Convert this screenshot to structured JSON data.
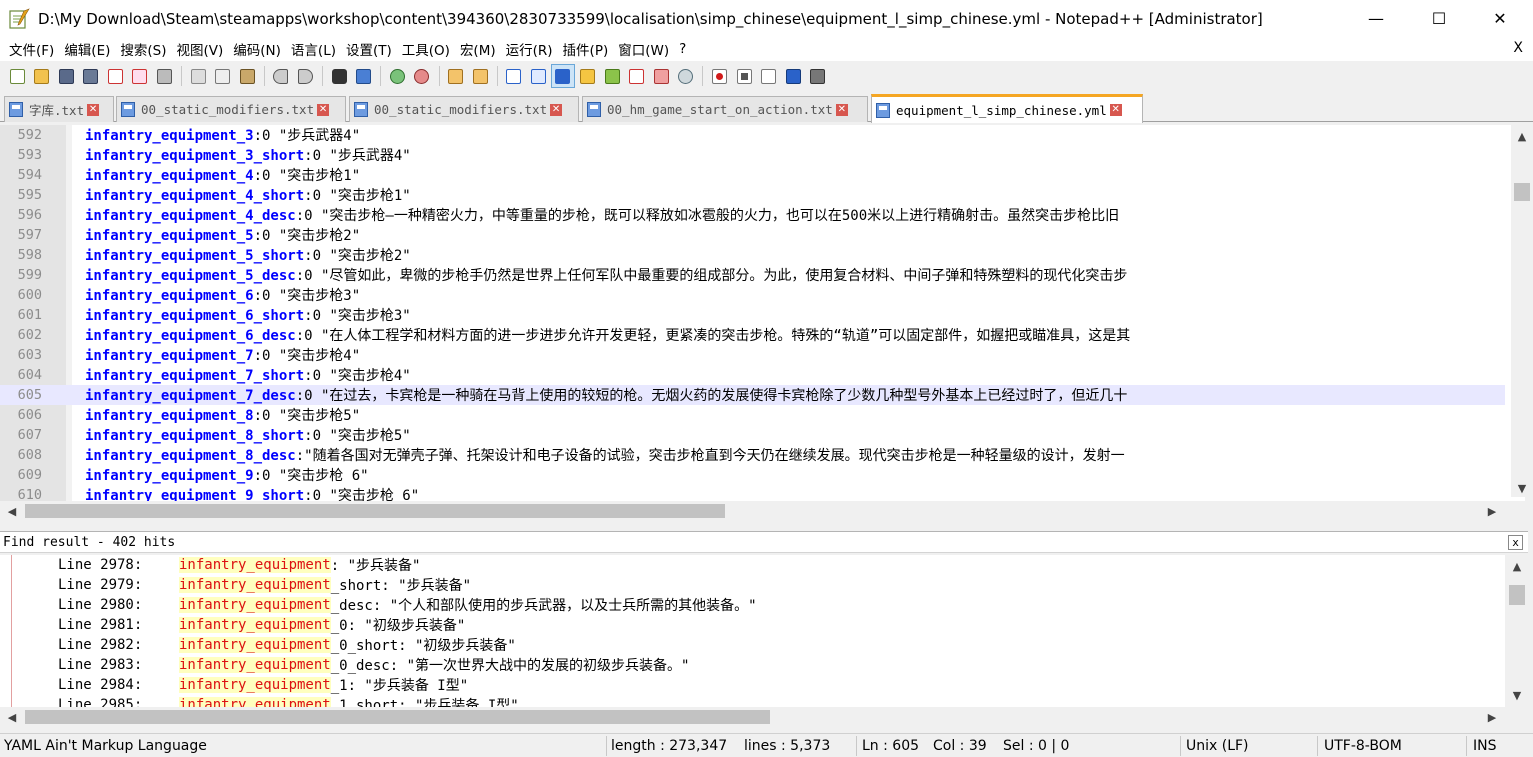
{
  "window": {
    "title": "D:\\My Download\\Steam\\steamapps\\workshop\\content\\394360\\2830733599\\localisation\\simp_chinese\\equipment_l_simp_chinese.yml - Notepad++ [Administrator]",
    "minimize": "—",
    "maximize": "☐",
    "close": "✕"
  },
  "menu": {
    "items": [
      "文件(F)",
      "编辑(E)",
      "搜索(S)",
      "视图(V)",
      "编码(N)",
      "语言(L)",
      "设置(T)",
      "工具(O)",
      "宏(M)",
      "运行(R)",
      "插件(P)",
      "窗口(W)",
      "?"
    ],
    "close": "X"
  },
  "toolbar": {
    "icons": [
      "new-file",
      "open-file",
      "save",
      "save-all",
      "close",
      "close-all",
      "print",
      "cut",
      "copy",
      "paste",
      "undo",
      "redo",
      "find",
      "replace",
      "zoom-in",
      "zoom-out",
      "sync-vertical",
      "sync-horizontal",
      "word-wrap",
      "show-all-chars",
      "indent-guide",
      "user-language",
      "doc-map",
      "function-list",
      "folder-as-workspace",
      "monitoring",
      "record-macro",
      "stop-record",
      "play-macro",
      "run-macro-multiple",
      "save-macro"
    ],
    "colors": {
      "accent": "#f5a623",
      "record": "#d11a1a",
      "blue": "#2a62c9"
    }
  },
  "tabs": [
    {
      "label": "字库.txt",
      "active": false
    },
    {
      "label": "00_static_modifiers.txt",
      "active": false
    },
    {
      "label": "00_static_modifiers.txt",
      "active": false
    },
    {
      "label": "00_hm_game_start_on_action.txt",
      "active": false
    },
    {
      "label": "equipment_l_simp_chinese.yml",
      "active": true
    }
  ],
  "editor": {
    "lines": [
      {
        "num": "592",
        "key": "infantry_equipment_3",
        "val": ":0 \"步兵武器4\""
      },
      {
        "num": "593",
        "key": "infantry_equipment_3_short",
        "val": ":0 \"步兵武器4\""
      },
      {
        "num": "594",
        "key": "infantry_equipment_4",
        "val": ":0 \"突击步枪1\""
      },
      {
        "num": "595",
        "key": "infantry_equipment_4_short",
        "val": ":0 \"突击步枪1\""
      },
      {
        "num": "596",
        "key": "infantry_equipment_4_desc",
        "val": ":0 \"突击步枪—一种精密火力，中等重量的步枪，既可以释放如冰雹般的火力，也可以在500米以上进行精确射击。虽然突击步枪比旧"
      },
      {
        "num": "597",
        "key": "infantry_equipment_5",
        "val": ":0 \"突击步枪2\""
      },
      {
        "num": "598",
        "key": "infantry_equipment_5_short",
        "val": ":0 \"突击步枪2\""
      },
      {
        "num": "599",
        "key": "infantry_equipment_5_desc",
        "val": ":0 \"尽管如此，卑微的步枪手仍然是世界上任何军队中最重要的组成部分。为此，使用复合材料、中间子弹和特殊塑料的现代化突击步"
      },
      {
        "num": "600",
        "key": "infantry_equipment_6",
        "val": ":0 \"突击步枪3\""
      },
      {
        "num": "601",
        "key": "infantry_equipment_6_short",
        "val": ":0 \"突击步枪3\""
      },
      {
        "num": "602",
        "key": "infantry_equipment_6_desc",
        "val": ":0 \"在人体工程学和材料方面的进一步进步允许开发更轻，更紧凑的突击步枪。特殊的“轨道”可以固定部件，如握把或瞄准具，这是其"
      },
      {
        "num": "603",
        "key": "infantry_equipment_7",
        "val": ":0 \"突击步枪4\""
      },
      {
        "num": "604",
        "key": "infantry_equipment_7_short",
        "val": ":0 \"突击步枪4\""
      },
      {
        "num": "605",
        "key": "infantry_equipment_7_desc",
        "val": ":0 \"在过去，卡宾枪是一种骑在马背上使用的较短的枪。无烟火药的发展使得卡宾枪除了少数几种型号外基本上已经过时了，但近几十"
      },
      {
        "num": "606",
        "key": "infantry_equipment_8",
        "val": ":0 \"突击步枪5\""
      },
      {
        "num": "607",
        "key": "infantry_equipment_8_short",
        "val": ":0 \"突击步枪5\""
      },
      {
        "num": "608",
        "key": "infantry_equipment_8_desc",
        "val": ":\"随着各国对无弹壳子弹、托架设计和电子设备的试验，突击步枪直到今天仍在继续发展。现代突击步枪是一种轻量级的设计，发射一"
      },
      {
        "num": "609",
        "key": "infantry_equipment_9",
        "val": ":0 \"突击步枪 6\""
      },
      {
        "num": "610",
        "key": "infantry_equipment_9_short",
        "val": ":0 \"突击步枪 6\""
      }
    ],
    "current_line": "605"
  },
  "find": {
    "header": "Find result - 402 hits",
    "close": "x",
    "results": [
      {
        "ref": "Line 2978:",
        "hit": "infantry_equipment",
        "rest": ": \"步兵装备\""
      },
      {
        "ref": "Line 2979:",
        "hit": "infantry_equipment",
        "rest": "_short: \"步兵装备\""
      },
      {
        "ref": "Line 2980:",
        "hit": "infantry_equipment",
        "rest": "_desc: \"个人和部队使用的步兵武器，以及士兵所需的其他装备。\""
      },
      {
        "ref": "Line 2981:",
        "hit": "infantry_equipment",
        "rest": "_0: \"初级步兵装备\""
      },
      {
        "ref": "Line 2982:",
        "hit": "infantry_equipment",
        "rest": "_0_short: \"初级步兵装备\""
      },
      {
        "ref": "Line 2983:",
        "hit": "infantry_equipment",
        "rest": "_0_desc: \"第一次世界大战中的发展的初级步兵装备。\""
      },
      {
        "ref": "Line 2984:",
        "hit": "infantry_equipment",
        "rest": "_1: \"步兵装备 I型\""
      },
      {
        "ref": "Line 2985:",
        "hit": "infantry_equipment",
        "rest": "_1_short: \"步兵装备 I型\""
      }
    ]
  },
  "status": {
    "language": "YAML Ain't Markup Language",
    "length": "length : 273,347",
    "lines": "lines : 5,373",
    "ln": "Ln : 605",
    "col": "Col : 39",
    "sel": "Sel : 0 | 0",
    "eol": "Unix (LF)",
    "encoding": "UTF-8-BOM",
    "mode": "INS"
  }
}
